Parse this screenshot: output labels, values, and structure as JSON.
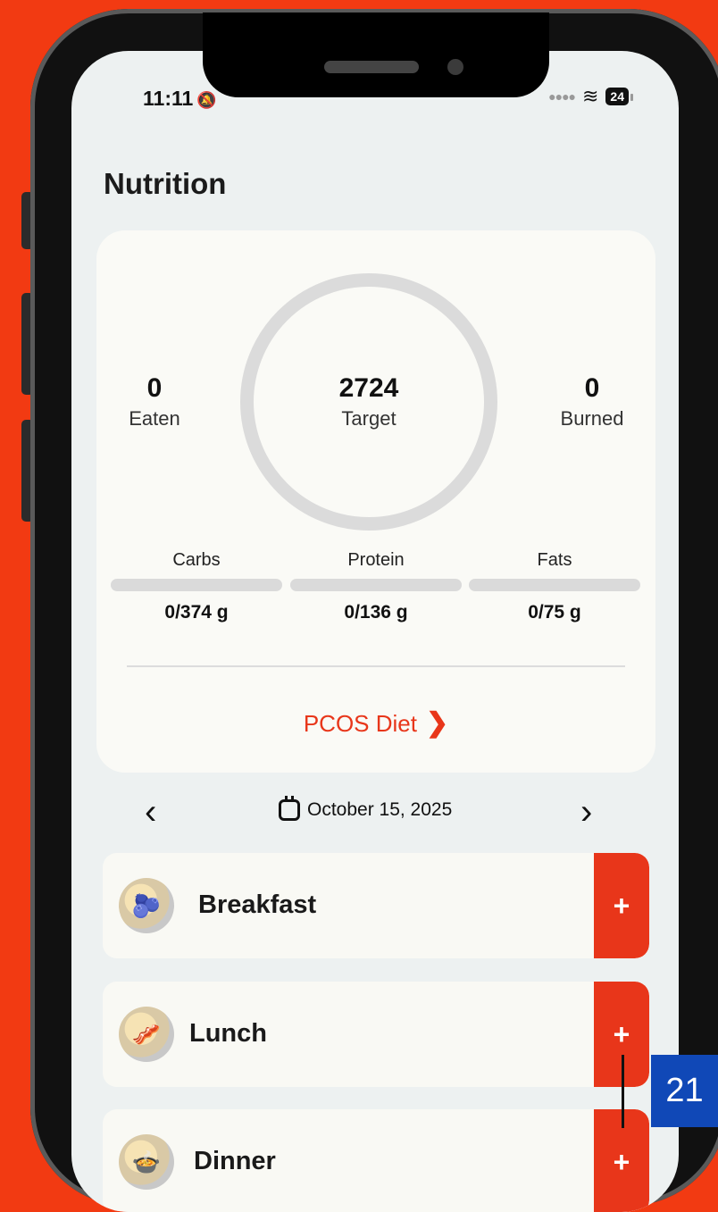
{
  "status_bar": {
    "time": "11:11",
    "battery": "24"
  },
  "page": {
    "title": "Nutrition"
  },
  "summary": {
    "eaten": {
      "value": "0",
      "label": "Eaten"
    },
    "target": {
      "value": "2724",
      "label": "Target"
    },
    "burned": {
      "value": "0",
      "label": "Burned"
    }
  },
  "macros": [
    {
      "label": "Carbs",
      "value": "0/374 g",
      "progress": 0
    },
    {
      "label": "Protein",
      "value": "0/136 g",
      "progress": 0
    },
    {
      "label": "Fats",
      "value": "0/75 g",
      "progress": 0
    }
  ],
  "diet_link": {
    "label": "PCOS Diet"
  },
  "date_nav": {
    "date": "October 15, 2025"
  },
  "meals": [
    {
      "name": "Breakfast",
      "icon": "oatmeal-bowl-icon"
    },
    {
      "name": "Lunch",
      "icon": "breakfast-plate-icon"
    },
    {
      "name": "Dinner",
      "icon": "dinner-bowl-icon"
    }
  ],
  "annotation": {
    "badge": "21"
  },
  "colors": {
    "accent": "#E8361A",
    "background": "#F23A12",
    "badge": "#1048B7"
  }
}
